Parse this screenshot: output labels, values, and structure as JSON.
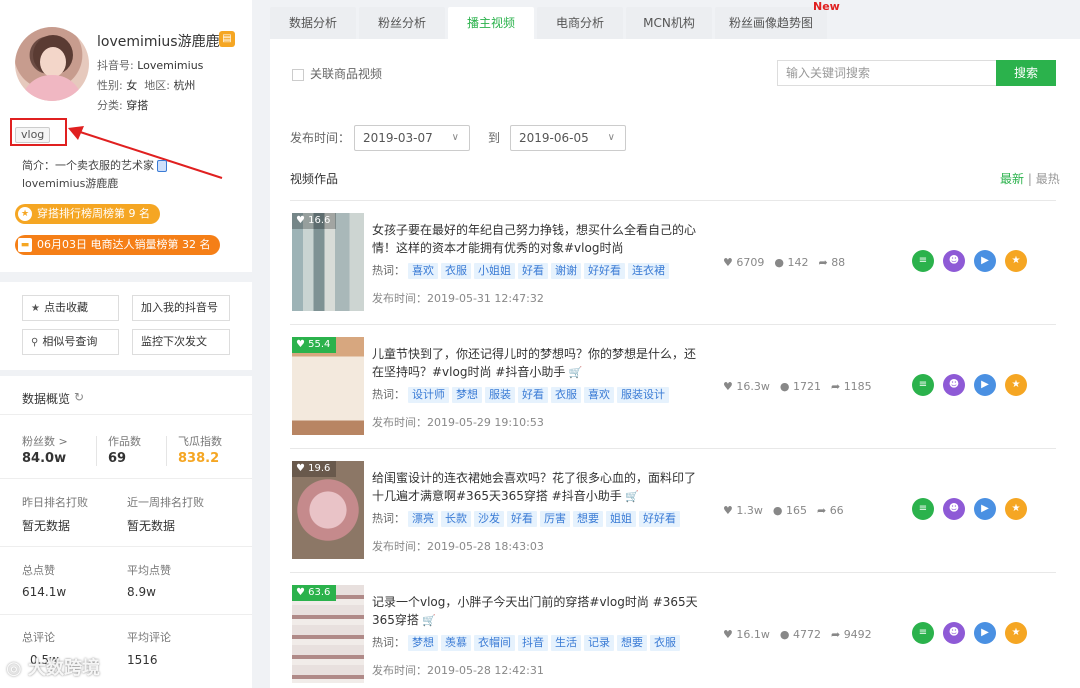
{
  "profile": {
    "username": "lovemimius游鹿鹿",
    "verified_icon": "badge-icon",
    "douyin_id_label": "抖音号:",
    "douyin_id": "Lovemimius",
    "gender_label": "性别:",
    "gender": "女",
    "region_label": "地区:",
    "region": "杭州",
    "category_label": "分类:",
    "category": "穿搭",
    "tag": "vlog",
    "bio_line1": "简介：一个卖衣服的艺术家",
    "bio_line2": "lovemimius游鹿鹿",
    "rank1": "穿搭排行榜周榜第 9 名",
    "rank2": "06月03日 电商达人销量榜第 32 名"
  },
  "actions": {
    "favorite": "点击收藏",
    "add_account": "加入我的抖音号",
    "similar": "相似号查询",
    "monitor": "监控下次发文"
  },
  "overview": {
    "title": "数据概览",
    "fans_label": "粉丝数 >",
    "fans": "84.0w",
    "works_label": "作品数",
    "works": "69",
    "index_label": "飞瓜指数",
    "index": "838.2",
    "yesterday_rank_label": "昨日排名打败",
    "yesterday_rank": "暂无数据",
    "week_rank_label": "近一周排名打败",
    "week_rank": "暂无数据",
    "likes_label": "总点赞",
    "likes": "614.1w",
    "avg_likes_label": "平均点赞",
    "avg_likes": "8.9w",
    "comments_label": "总评论",
    "comments": "0.5w",
    "avg_comments_label": "平均评论",
    "avg_comments": "1516"
  },
  "tabs": [
    "数据分析",
    "粉丝分析",
    "播主视频",
    "电商分析",
    "MCN机构",
    "粉丝画像趋势图"
  ],
  "new_label": "New",
  "filter": {
    "related_goods": "关联商品视频",
    "search_placeholder": "输入关键词搜索",
    "search_button": "搜索",
    "date_label": "发布时间：",
    "date_from": "2019-03-07",
    "to_label": "到",
    "date_to": "2019-06-05"
  },
  "list": {
    "title": "视频作品",
    "sort_latest": "最新",
    "sort_sep": "|",
    "sort_hot": "最热",
    "keywords_label": "热词：",
    "time_label": "发布时间：",
    "videos": [
      {
        "score": "16.6",
        "title": "女孩子要在最好的年纪自己努力挣钱，想买什么全看自己的心情！这样的资本才能拥有优秀的对象#vlog时尚",
        "keywords": [
          "喜欢",
          "衣服",
          "小姐姐",
          "好看",
          "谢谢",
          "好好看",
          "连衣裙"
        ],
        "time": "2019-05-31 12:47:32",
        "likes": "6709",
        "comments": "142",
        "shares": "88",
        "has_cart": false
      },
      {
        "score": "55.4",
        "title": "儿童节快到了，你还记得儿时的梦想吗？你的梦想是什么，还在坚持吗？#vlog时尚 #抖音小助手",
        "keywords": [
          "设计师",
          "梦想",
          "服装",
          "好看",
          "衣服",
          "喜欢",
          "服装设计"
        ],
        "time": "2019-05-29 19:10:53",
        "likes": "16.3w",
        "comments": "1721",
        "shares": "1185",
        "has_cart": true
      },
      {
        "score": "19.6",
        "title": "给闺蜜设计的连衣裙她会喜欢吗？花了很多心血的，面料印了十几遍才满意啊#365天365穿搭 #抖音小助手",
        "keywords": [
          "漂亮",
          "长款",
          "沙发",
          "好看",
          "厉害",
          "想要",
          "姐姐",
          "好好看"
        ],
        "time": "2019-05-28 18:43:03",
        "likes": "1.3w",
        "comments": "165",
        "shares": "66",
        "has_cart": true
      },
      {
        "score": "63.6",
        "title": "记录一个vlog，小胖子今天出门前的穿搭#vlog时尚 #365天365穿搭",
        "keywords": [
          "梦想",
          "羡慕",
          "衣帽间",
          "抖音",
          "生活",
          "记录",
          "想要",
          "衣服"
        ],
        "time": "2019-05-28 12:42:31",
        "likes": "16.1w",
        "comments": "4772",
        "shares": "9492",
        "has_cart": true
      }
    ]
  },
  "colors": {
    "accent": "#2bb24c",
    "orange": "#f5a623",
    "purple": "#8e5ad6",
    "blue": "#4a90e2"
  },
  "watermark": "大数跨境"
}
